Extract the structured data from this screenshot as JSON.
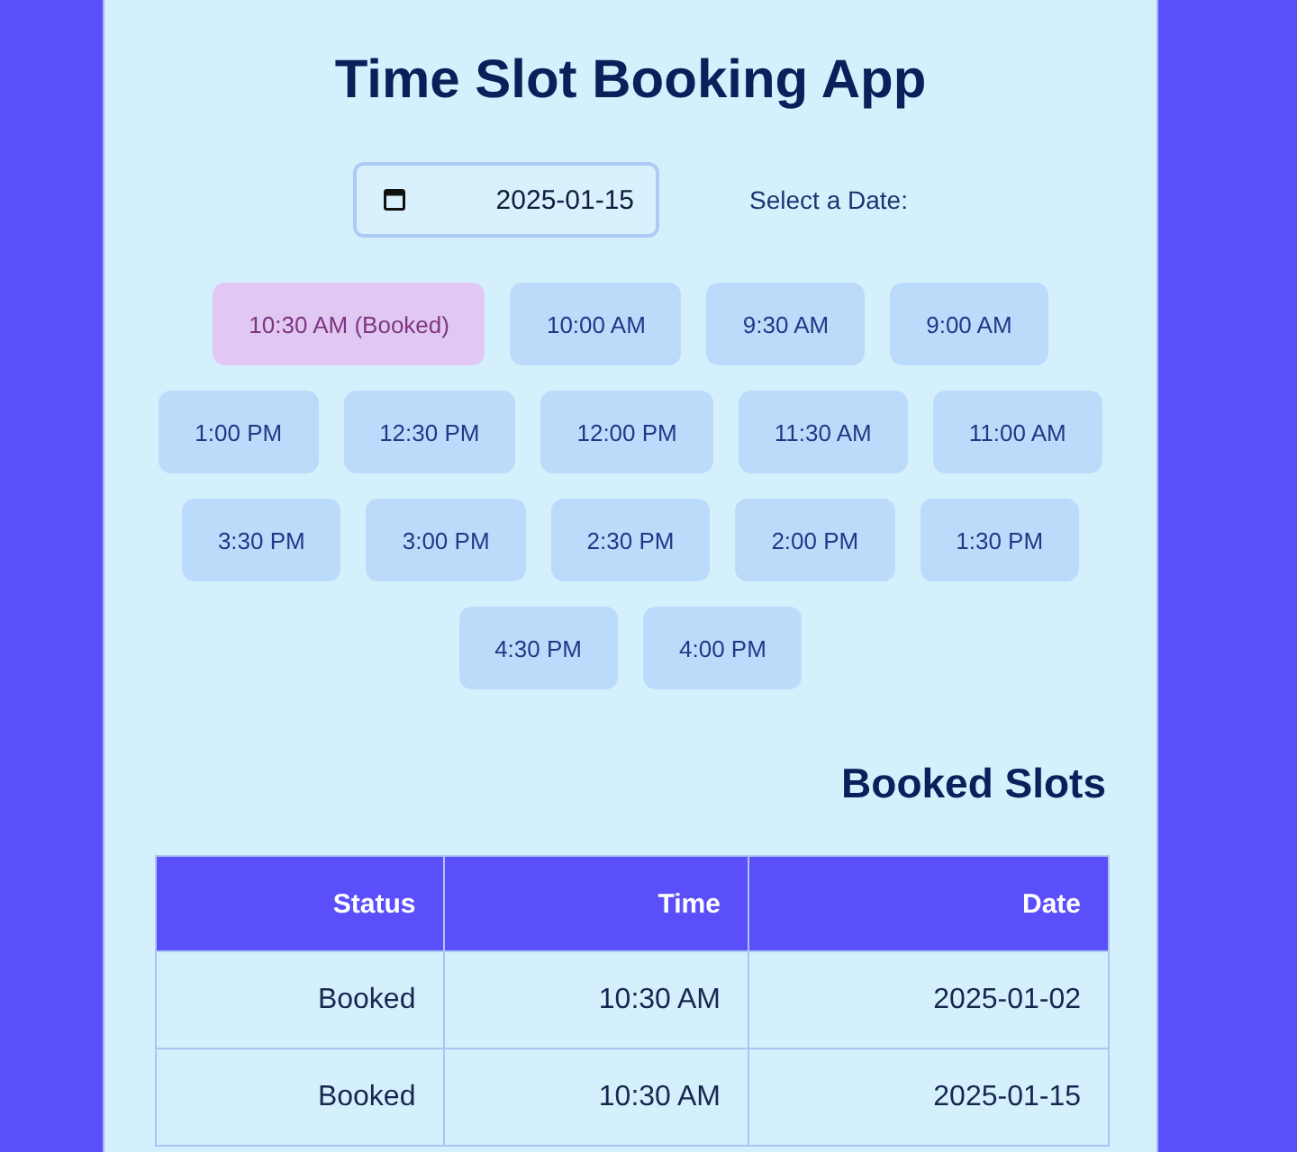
{
  "title": "Time Slot Booking App",
  "date_picker": {
    "label": "Select a Date:",
    "value": "2025-01-15"
  },
  "slots": [
    {
      "label": "10:30 AM (Booked)",
      "booked": true
    },
    {
      "label": "10:00 AM",
      "booked": false
    },
    {
      "label": "9:30 AM",
      "booked": false
    },
    {
      "label": "9:00 AM",
      "booked": false
    },
    {
      "label": "1:00 PM",
      "booked": false
    },
    {
      "label": "12:30 PM",
      "booked": false
    },
    {
      "label": "12:00 PM",
      "booked": false
    },
    {
      "label": "11:30 AM",
      "booked": false
    },
    {
      "label": "11:00 AM",
      "booked": false
    },
    {
      "label": "3:30 PM",
      "booked": false
    },
    {
      "label": "3:00 PM",
      "booked": false
    },
    {
      "label": "2:30 PM",
      "booked": false
    },
    {
      "label": "2:00 PM",
      "booked": false
    },
    {
      "label": "1:30 PM",
      "booked": false
    },
    {
      "label": "4:30 PM",
      "booked": false
    },
    {
      "label": "4:00 PM",
      "booked": false
    }
  ],
  "booked_slots": {
    "title": "Booked Slots",
    "columns": [
      "Status",
      "Time",
      "Date"
    ],
    "rows": [
      [
        "Booked",
        "10:30 AM",
        "2025-01-02"
      ],
      [
        "Booked",
        "10:30 AM",
        "2025-01-15"
      ]
    ]
  }
}
